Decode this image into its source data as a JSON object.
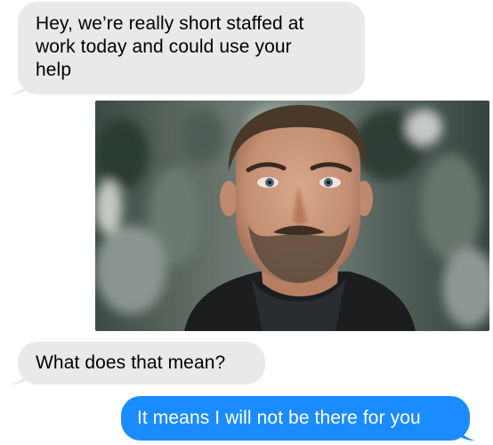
{
  "conversation": {
    "messages": [
      {
        "direction": "received",
        "lines": [
          "Hey, we’re really short staffed at",
          "work today and could use your",
          "help"
        ]
      },
      {
        "direction": "received",
        "type": "image",
        "icon": "photo-of-man-staring-icon"
      },
      {
        "direction": "received",
        "text": "What does that mean?"
      },
      {
        "direction": "sent",
        "text": "It means I will not be there for you"
      }
    ]
  },
  "colors": {
    "received_bubble": "#e9e9eb",
    "sent_bubble": "#1a8cff",
    "sent_text": "#ffffff",
    "received_text": "#000000"
  }
}
